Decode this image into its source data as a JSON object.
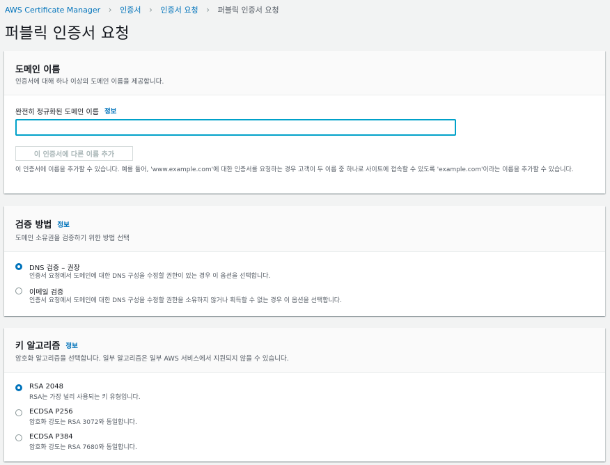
{
  "breadcrumb": {
    "items": [
      "AWS Certificate Manager",
      "인증서",
      "인증서 요청"
    ],
    "current": "퍼블릭 인증서 요청"
  },
  "page": {
    "title": "퍼블릭 인증서 요청"
  },
  "domain_section": {
    "title": "도메인 이름",
    "description": "인증서에 대해 하나 이상의 도메인 이름을 제공합니다.",
    "field_label": "완전히 정규화된 도메인 이름",
    "info": "정보",
    "input_value": "",
    "add_button": "이 인증서에 다른 이름 추가",
    "help": "이 인증서에 이름을 추가할 수 있습니다. 예를 들어, 'www.example.com'에 대한 인증서를 요청하는 경우 고객이 두 이름 중 하나로 사이트에 접속할 수 있도록 'example.com'이라는 이름을 추가할 수 있습니다."
  },
  "validation_section": {
    "title": "검증 방법",
    "info": "정보",
    "description": "도메인 소유권을 검증하기 위한 방법 선택",
    "options": [
      {
        "label": "DNS 검증 – 권장",
        "description": "인증서 요청에서 도메인에 대한 DNS 구성을 수정할 권한이 있는 경우 이 옵션을 선택합니다.",
        "selected": true
      },
      {
        "label": "이메일 검증",
        "description": "인증서 요청에서 도메인에 대한 DNS 구성을 수정할 권한을 소유하지 않거나 획득할 수 없는 경우 이 옵션을 선택합니다.",
        "selected": false
      }
    ]
  },
  "key_section": {
    "title": "키 알고리즘",
    "info": "정보",
    "description": "암호화 알고리즘을 선택합니다. 일부 알고리즘은 일부 AWS 서비스에서 지원되지 않을 수 있습니다.",
    "options": [
      {
        "label": "RSA 2048",
        "description": "RSA는 가장 널리 사용되는 키 유형입니다.",
        "selected": true
      },
      {
        "label": "ECDSA P256",
        "description": "암호화 강도는 RSA 3072와 동일합니다.",
        "selected": false
      },
      {
        "label": "ECDSA P384",
        "description": "암호화 강도는 RSA 7680와 동일합니다.",
        "selected": false
      }
    ]
  },
  "colors": {
    "link": "#0073bb",
    "focus": "#00a1c9",
    "background": "#f2f3f3"
  }
}
